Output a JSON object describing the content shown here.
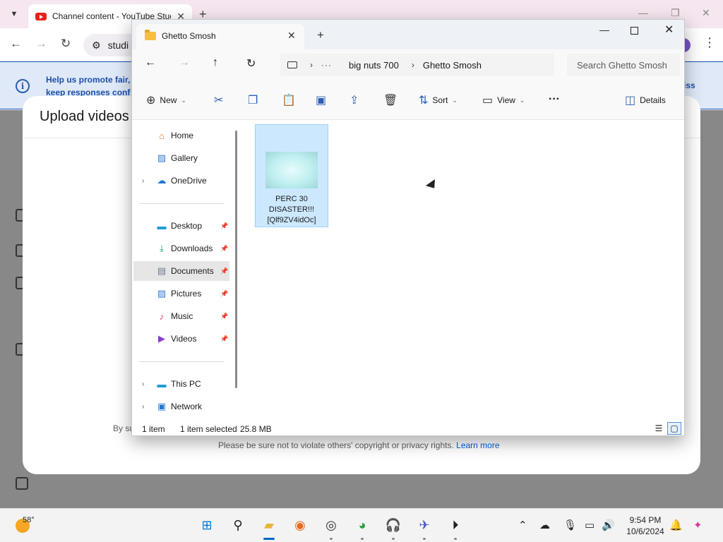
{
  "browser": {
    "tab_title": "Channel content - YouTube Studio",
    "omnibox_text": "studi",
    "banner_text": "Help us promote fair, keep responses conf",
    "banner_dismiss": "iss"
  },
  "upload": {
    "title": "Upload videos",
    "terms_prefix": "By su",
    "notice": "Please be sure not to violate others' copyright or privacy rights.",
    "learn_more": "Learn more"
  },
  "explorer": {
    "tab_title": "Ghetto Smosh",
    "breadcrumb": [
      "big nuts 700",
      "Ghetto Smosh"
    ],
    "search_placeholder": "Search Ghetto Smosh",
    "commands": {
      "new": "New",
      "sort": "Sort",
      "view": "View",
      "details": "Details"
    },
    "nav": {
      "home": "Home",
      "gallery": "Gallery",
      "onedrive": "OneDrive",
      "desktop": "Desktop",
      "downloads": "Downloads",
      "documents": "Documents",
      "pictures": "Pictures",
      "music": "Music",
      "videos": "Videos",
      "this_pc": "This PC",
      "network": "Network"
    },
    "file": {
      "name": "PERC 30 DISASTER!!! [Qlf9ZV4idOc]"
    },
    "status": {
      "count": "1 item",
      "selection": "1 item selected",
      "size": "25.8 MB"
    }
  },
  "taskbar": {
    "temperature": "58°",
    "time": "9:54 PM",
    "date": "10/6/2024"
  }
}
